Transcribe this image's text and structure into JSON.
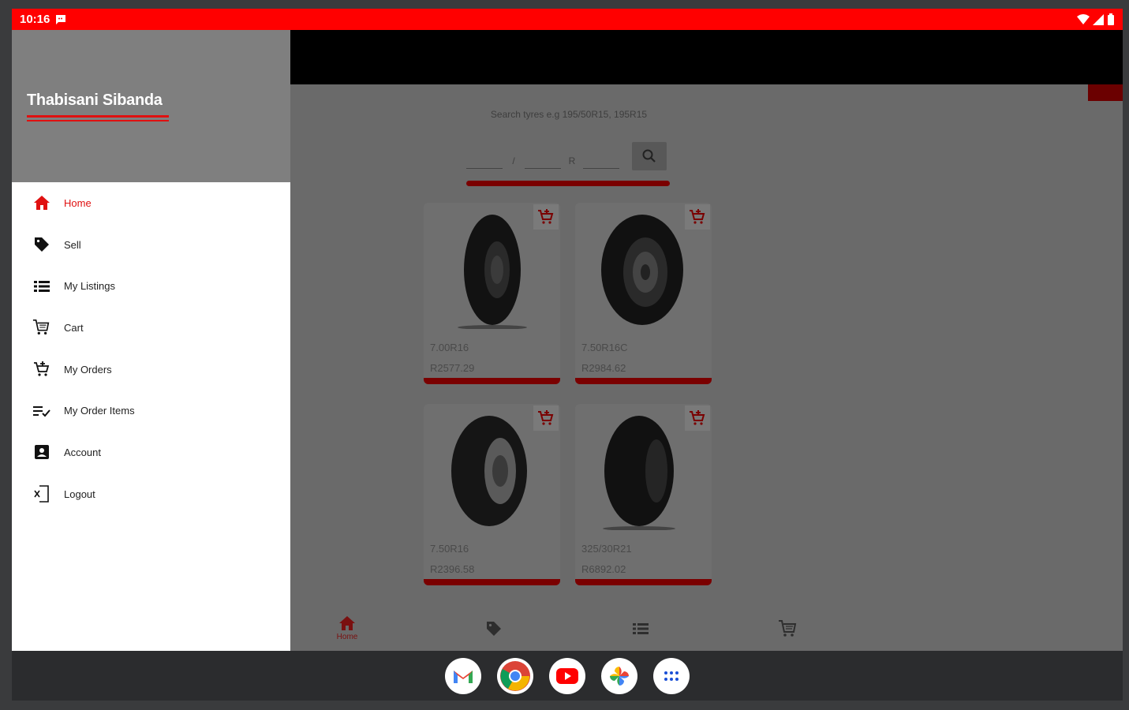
{
  "status_bar": {
    "time": "10:16"
  },
  "search": {
    "hint": "Search tyres e.g 195/50R15, 195R15",
    "sep_slash": "/",
    "sep_r": "R"
  },
  "products": [
    {
      "size": "7.00R16",
      "price": "R2577.29"
    },
    {
      "size": "7.50R16C",
      "price": "R2984.62"
    },
    {
      "size": "7.50R16",
      "price": "R2396.58"
    },
    {
      "size": "325/30R21",
      "price": "R6892.02"
    }
  ],
  "bottom_nav": {
    "home_label": "Home"
  },
  "drawer": {
    "user_name": "Thabisani Sibanda",
    "items": [
      {
        "label": "Home",
        "icon": "home-icon"
      },
      {
        "label": "Sell",
        "icon": "tag-icon"
      },
      {
        "label": "My Listings",
        "icon": "list-icon"
      },
      {
        "label": "Cart",
        "icon": "cart-icon"
      },
      {
        "label": "My Orders",
        "icon": "cart-add-icon"
      },
      {
        "label": "My Order Items",
        "icon": "checklist-icon"
      },
      {
        "label": "Account",
        "icon": "account-box-icon"
      },
      {
        "label": "Logout",
        "icon": "logout-icon"
      }
    ]
  },
  "colors": {
    "accent": "#ff0000",
    "dark_accent": "#7a0000"
  }
}
